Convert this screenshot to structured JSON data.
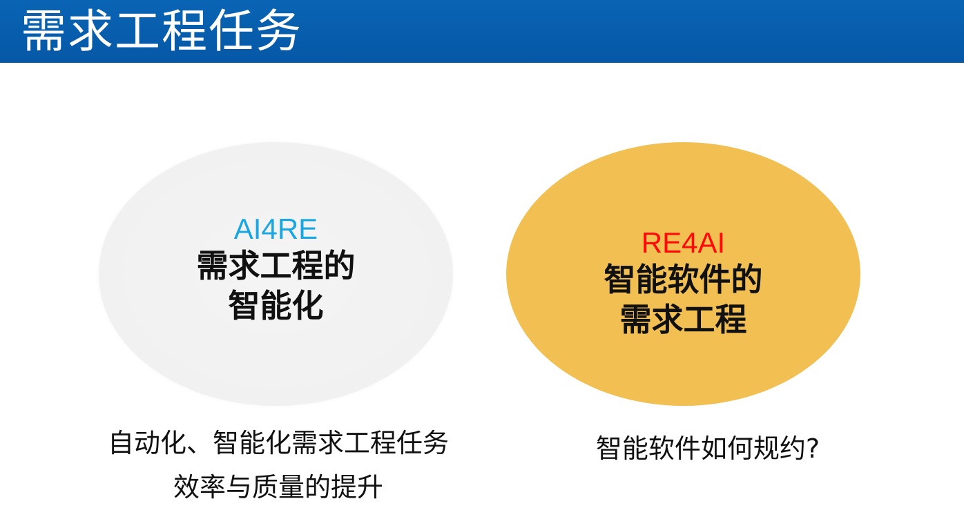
{
  "header": {
    "title": "需求工程任务",
    "background": "#0a5fb0"
  },
  "left_circle": {
    "label": "AI4RE",
    "label_color": "#1aa6e0",
    "main_lines": [
      "需求工程的",
      "智能化"
    ],
    "fill": "#f1f1f1"
  },
  "right_circle": {
    "label": "RE4AI",
    "label_color": "#ff0a0a",
    "main_lines": [
      "智能软件的",
      "需求工程"
    ],
    "fill": "#f1bf52"
  },
  "left_caption": {
    "lines": [
      "自动化、智能化需求工程任务",
      "效率与质量的提升"
    ]
  },
  "right_caption": {
    "lines": [
      "智能软件如何规约?"
    ]
  }
}
